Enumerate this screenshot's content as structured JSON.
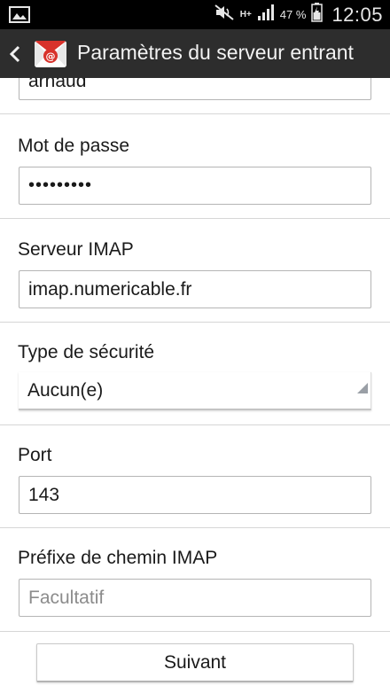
{
  "status_bar": {
    "network_type": "H+",
    "battery_percent": "47 %",
    "time": "12:05",
    "icons": [
      "image-icon",
      "mute-icon",
      "signal-icon",
      "battery-icon"
    ]
  },
  "action_bar": {
    "title": "Paramètres du serveur entrant",
    "icons": [
      "back-chevron-icon",
      "email-app-icon"
    ],
    "colors": {
      "background": "#2d2d2d",
      "app_icon_red": "#d8322b"
    }
  },
  "form": {
    "username": {
      "value": "arnaud"
    },
    "password": {
      "label": "Mot de passe",
      "value": "•••••••••"
    },
    "imap_server": {
      "label": "Serveur IMAP",
      "value": "imap.numericable.fr"
    },
    "security_type": {
      "label": "Type de sécurité",
      "selected": "Aucun(e)"
    },
    "port": {
      "label": "Port",
      "value": "143"
    },
    "imap_path_prefix": {
      "label": "Préfixe de chemin IMAP",
      "placeholder": "Facultatif"
    }
  },
  "buttons": {
    "next_label": "Suivant"
  }
}
